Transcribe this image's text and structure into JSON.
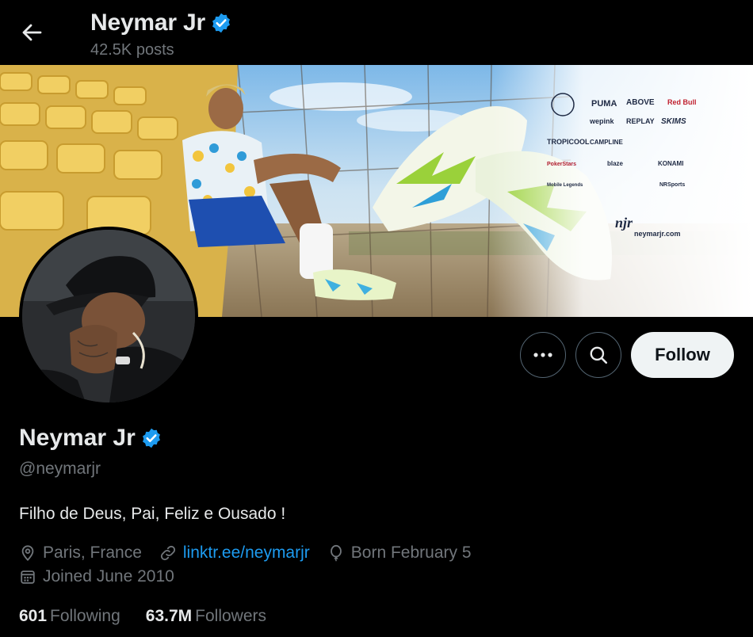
{
  "header": {
    "name": "Neymar Jr",
    "posts": "42.5K posts"
  },
  "banner": {
    "sponsors": [
      "PUMA",
      "ABOVE",
      "Red Bull",
      "wepink",
      "REPLAY",
      "SKIMS",
      "TROPICOOL",
      "CAMPLINE",
      "PokerStars",
      "blaze",
      "KONAMI",
      "Mobile Legends",
      "NRSports"
    ],
    "website": "neymarjr.com",
    "logo": "njr"
  },
  "actions": {
    "follow_label": "Follow"
  },
  "profile": {
    "name": "Neymar Jr",
    "handle": "@neymarjr",
    "bio": "Filho de Deus, Pai, Feliz e Ousado !",
    "location": "Paris, France",
    "website": "linktr.ee/neymarjr",
    "birthday": "Born February 5",
    "joined": "Joined June 2010"
  },
  "stats": {
    "following_count": "601",
    "following_label": "Following",
    "followers_count": "63.7M",
    "followers_label": "Followers"
  },
  "colors": {
    "background": "#000000",
    "text_primary": "#e7e9ea",
    "text_secondary": "#71767b",
    "link": "#1d9bf0",
    "verified": "#1d9bf0",
    "follow_button_bg": "#eff3f4"
  }
}
